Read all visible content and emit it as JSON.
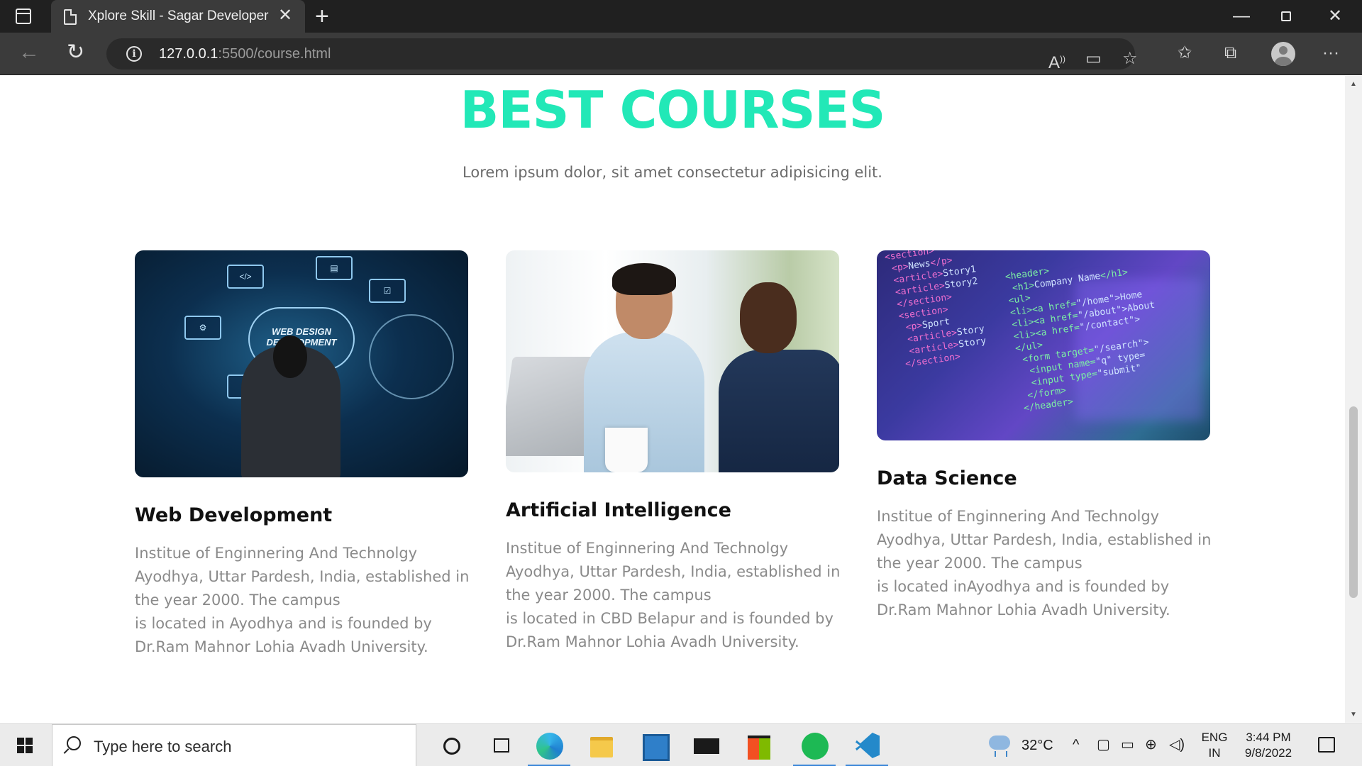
{
  "browser": {
    "tab_title": "Xplore Skill - Sagar Developer",
    "url_host": "127.0.0.1",
    "url_path": ":5500/course.html"
  },
  "page": {
    "heading": "BEST COURSES",
    "subheading": "Lorem ipsum dolor, sit amet consectetur adipisicing elit.",
    "courses": [
      {
        "title": "Web Development",
        "image_text": "WEB DESIGN DEVELOPMENT",
        "description": [
          "Institue of Enginnering And Technolgy",
          "Ayodhya, Uttar Pardesh, India, established in",
          "the year 2000. The campus",
          "is located in Ayodhya and is founded by",
          "Dr.Ram Mahnor Lohia Avadh University."
        ]
      },
      {
        "title": "Artificial Intelligence",
        "description": [
          "Institue of Enginnering And Technolgy",
          "Ayodhya, Uttar Pardesh, India, established in",
          "the year 2000. The campus",
          "is located in CBD Belapur and is founded by",
          "Dr.Ram Mahnor Lohia Avadh University."
        ]
      },
      {
        "title": "Data Science",
        "description": [
          "Institue of Enginnering And Technolgy",
          "Ayodhya, Uttar Pardesh, India, established in",
          "the year 2000. The campus",
          "is located inAyodhya and is founded by",
          "Dr.Ram Mahnor Lohia Avadh University."
        ]
      }
    ]
  },
  "taskbar": {
    "search_placeholder": "Type here to search",
    "temperature": "32°C",
    "lang_top": "ENG",
    "lang_bottom": "IN",
    "time": "3:44 PM",
    "date": "9/8/2022"
  },
  "colors": {
    "accent": "#22e8b7",
    "title_text": "#111111",
    "body_text": "#8a8a8a"
  }
}
